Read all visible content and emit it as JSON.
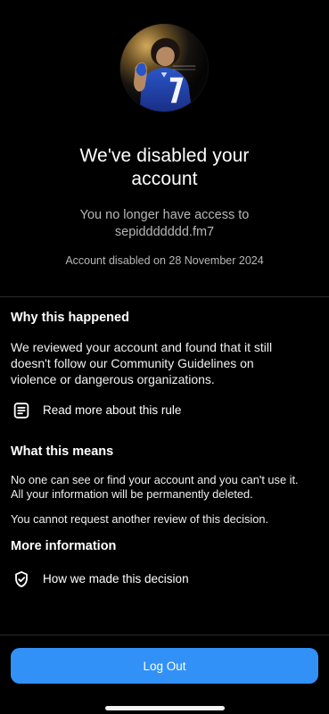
{
  "header": {
    "title_lines": [
      "We've disabled your",
      "account"
    ],
    "subtitle_lines": [
      "You no longer have access to",
      "sepiddddddd.fm7"
    ],
    "disabled_on": "Account disabled on 28 November 2024"
  },
  "sections": {
    "why": {
      "title": "Why this happened",
      "lines": [
        "We reviewed your account and found that it still",
        "doesn't follow our Community Guidelines on",
        "violence or dangerous organizations."
      ],
      "link_label": "Read more about this rule",
      "link_icon": "document-lines-icon"
    },
    "means": {
      "title": "What this means",
      "lines": [
        "No one can see or find your account and you can't use it.",
        "All your information will be permanently deleted."
      ],
      "line_2": "You cannot request another review of this decision."
    },
    "more": {
      "title": "More information",
      "link_label": "How we made this decision",
      "link_icon": "shield-check-icon"
    }
  },
  "actions": {
    "logout_label": "Log Out"
  },
  "colors": {
    "background": "#000000",
    "primary": "#3191f7",
    "secondary_text": "#b7b7b7",
    "divider": "#2a2a2a"
  }
}
